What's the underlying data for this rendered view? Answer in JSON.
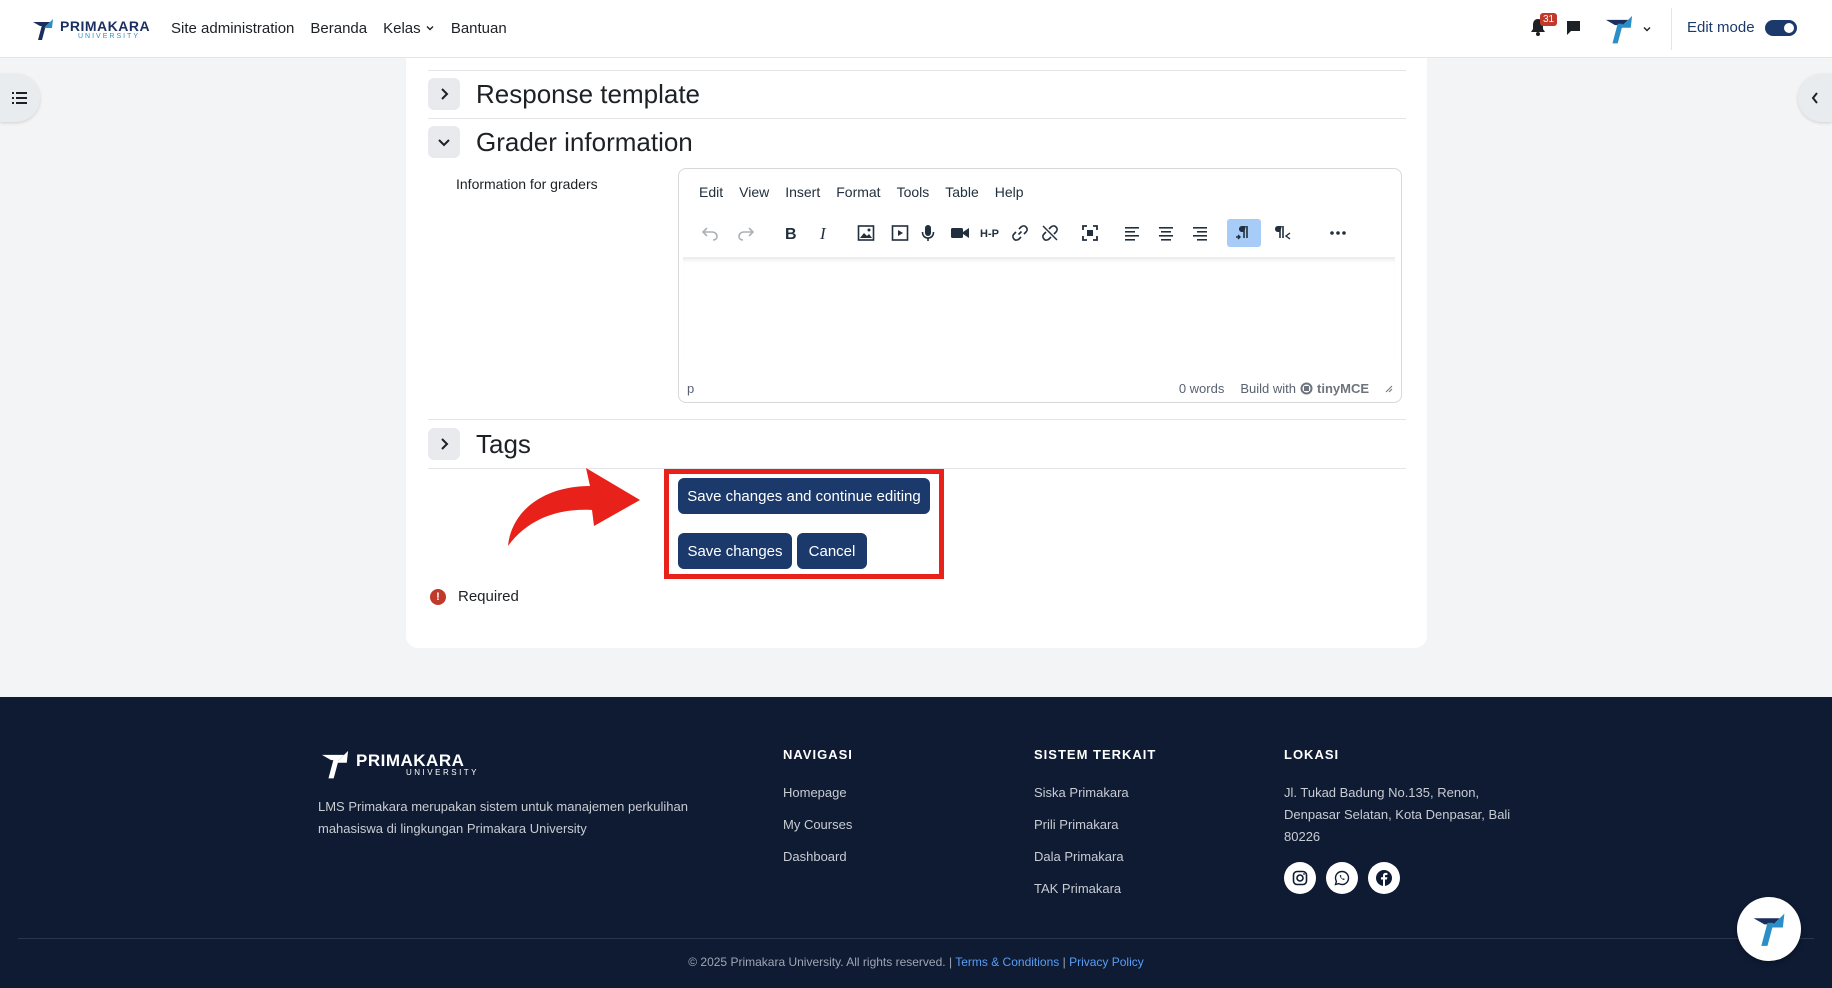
{
  "navbar": {
    "logo_title": "PRIMAKARA",
    "logo_sub": "UNIVERSITY",
    "links": [
      "Site administration",
      "Beranda",
      "Kelas",
      "Bantuan"
    ],
    "kelas_chevron": "⌄",
    "notifications_count": "31",
    "edit_mode_label": "Edit mode",
    "edit_mode_on": true
  },
  "sections": {
    "response_template": "Response template",
    "grader_information": "Grader information",
    "tags": "Tags"
  },
  "grader": {
    "label": "Information for graders"
  },
  "editor": {
    "menu": [
      "Edit",
      "View",
      "Insert",
      "Format",
      "Tools",
      "Table",
      "Help"
    ],
    "status_path": "p",
    "word_count": "0 words",
    "build_with": "Build with",
    "brand": "tinyMCE"
  },
  "actions": {
    "save_continue": "Save changes and continue editing",
    "save": "Save changes",
    "cancel": "Cancel"
  },
  "required": {
    "icon": "!",
    "label": "Required"
  },
  "footer": {
    "logo_title": "PRIMAKARA",
    "logo_sub": "UNIVERSITY",
    "description": "LMS Primakara merupakan sistem untuk manajemen perkulihan mahasiswa di lingkungan Primakara University",
    "nav_title": "NAVIGASI",
    "nav_links": [
      "Homepage",
      "My Courses",
      "Dashboard"
    ],
    "system_title": "SISTEM TERKAIT",
    "system_links": [
      "Siska Primakara",
      "Prili Primakara",
      "Dala Primakara",
      "TAK Primakara"
    ],
    "location_title": "LOKASI",
    "address": "Jl. Tukad Badung No.135, Renon, Denpasar Selatan, Kota Denpasar, Bali 80226",
    "copyright": "© 2025 Primakara University. All rights reserved.",
    "separator": "|",
    "terms": "Terms & Conditions",
    "privacy": "Privacy Policy"
  },
  "colors": {
    "brand_navy": "#1b3a6b",
    "highlight_red": "#e8211a",
    "footer_bg": "#0e1b33"
  }
}
